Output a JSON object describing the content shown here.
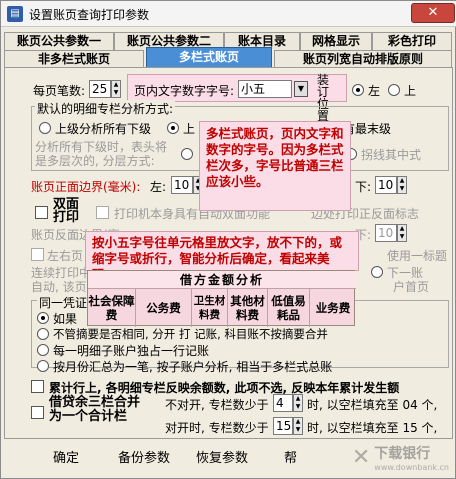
{
  "window": {
    "title": "设置账页查询打印参数",
    "close_label": "✕"
  },
  "tabs_row1": [
    "账页公共参数一",
    "账页公共参数二",
    "账本目录",
    "网格显示",
    "彩色打印"
  ],
  "tabs_row2": [
    "非多栏式账页",
    "多栏式账页",
    "账页列宽自动排版原则"
  ],
  "form": {
    "pen_count_label": "每页笔数:",
    "pen_count_value": "25",
    "font_size_label": "页内文字数字字号:",
    "font_size_value": "小五",
    "binding_label": "装订位置",
    "binding_left": "左",
    "binding_up": "上",
    "default_analysis_label": "默认的明细专栏分析方式:",
    "opt_upper_all": "上级分析所有下级",
    "opt_upper_partial": "上",
    "opt_all_lowest": "所有最末级",
    "gray_text_1": "分析所有下级时，表头将",
    "gray_text_2": "是多层次的, 分层方式:",
    "gray_label_3": "拐线其中式",
    "front_margin_label": "账页正面边界(毫米):",
    "left_label": "左:",
    "left_value": "10",
    "down_label": "下:",
    "down_value": "10",
    "duplex_label": "双面打印",
    "gray_printer_duplex": "打印机本身具有自动双面功能",
    "gray_bind_reverse": "边处打印正反面标志",
    "back_margin_label": "账页反面边界(毫",
    "back_down_value": "10",
    "gray_left_right_1": "左右页",
    "gray_continuous": "连续打印中",
    "gray_auto": "自动, 该页页",
    "gray_use_title": "使用一标题",
    "gray_next_page": "下一账",
    "gray_user_page": "户首页",
    "same_voucher_label": "同一凭证",
    "opt_if": "如果",
    "opt_not_merge": "不管摘要是否相同, 分开 打 记账, 科目账不按摘要合并",
    "opt_each_line": "每一明细子账户独占一行记账",
    "opt_month_summary": "按月份汇总为一笔, 按子账户分析, 相当于多栏式总账",
    "cumulative_label": "累计行上, 各明细专栏反映余额数, 此项不选, 反映本年累计发生额",
    "debit_credit_label": "借贷余三栏合并为一个合计栏",
    "not_open_label": "不对开, 专栏数少于",
    "not_open_value": "4",
    "not_open_tail": "时, 以空栏填充至 04 个,",
    "open_label": "对开时, 专栏数少于",
    "open_value": "15",
    "open_tail": "时, 以空栏填充至 15 个,"
  },
  "annotations": {
    "note1": "多栏式账页，页内文字和数字的字号。因为多栏式栏次多，字号比普通三栏应该小些。",
    "note2": "按小五字号往单元格里放文字，放不下的，或缩字号或折行，智能分析后确定，看起来美观。"
  },
  "table": {
    "header": "借方金额分析",
    "cells": [
      "社会保障费",
      "公务费",
      "卫生材料费",
      "其他材料费",
      "低值易耗品",
      "业务费"
    ]
  },
  "buttons": {
    "ok": "确定",
    "backup": "备份参数",
    "restore": "恢复参数",
    "help": "帮"
  },
  "watermark": {
    "text": "下载银行",
    "url": "www.downbank.cn"
  }
}
